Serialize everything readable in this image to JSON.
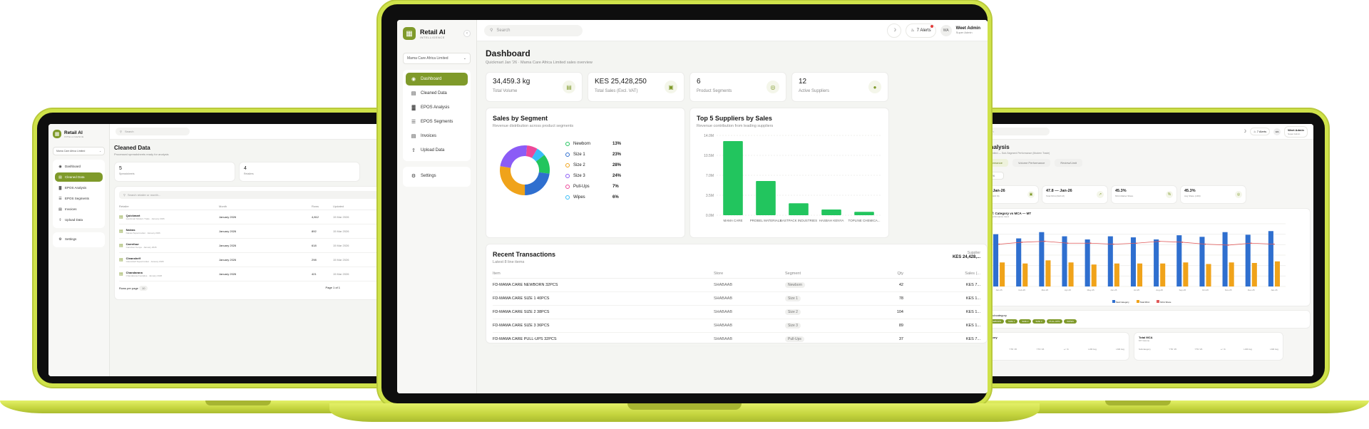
{
  "colors": {
    "accent": "#7f9a2a",
    "green": "#22c55e",
    "blue": "#2f6fcf",
    "orange": "#f0a31a",
    "red": "#e05a5a",
    "pink": "#ec4899"
  },
  "brand": {
    "name": "Retail AI",
    "tagline": "INTELLIGENCE"
  },
  "organization": "Mama Care Africa Limited",
  "nav": [
    {
      "label": "Dashboard",
      "icon": "dashboard-icon"
    },
    {
      "label": "Cleaned Data",
      "icon": "database-icon"
    },
    {
      "label": "EPOS Analysis",
      "icon": "bar-chart-icon"
    },
    {
      "label": "EPOS Segments",
      "icon": "layers-icon"
    },
    {
      "label": "Invoices",
      "icon": "file-icon"
    },
    {
      "label": "Upload Data",
      "icon": "upload-icon"
    }
  ],
  "settings_label": "Settings",
  "search_placeholder": "Search",
  "center": {
    "alerts": "7 Alerts",
    "user_initials": "WA",
    "user_name": "Weet Admin",
    "user_role": "Super Admin",
    "title": "Dashboard",
    "subtitle": "Quickmart Jan '26 · Mama Care Africa Limited sales overview",
    "kpis": [
      {
        "value": "34,459.3 kg",
        "label": "Total Volume",
        "icon": "bag-icon"
      },
      {
        "value": "KES 25,428,250",
        "label": "Total Sales (Excl. VAT)",
        "icon": "cash-icon"
      },
      {
        "value": "6",
        "label": "Product Segments",
        "icon": "target-icon"
      },
      {
        "value": "12",
        "label": "Active Suppliers",
        "icon": "truck-icon"
      }
    ],
    "segments_title": "Sales by Segment",
    "segments_sub": "Revenue distribution across product segments",
    "suppliers_title": "Top 5 Suppliers by Sales",
    "suppliers_sub": "Revenue contribution from leading suppliers",
    "tx_title": "Recent Transactions",
    "tx_sub": "Latest 8 line items",
    "tx_summary_label": "Supplier",
    "tx_summary_value": "KES 24,428,...",
    "tx_headers": [
      "Item",
      "Store",
      "Segment",
      "Qty",
      "Sales (..."
    ],
    "tx_rows": [
      [
        "FD-MAMA CARE NEWBORN 32PCS",
        "SHABAAB",
        "Newborn",
        "42",
        "KES 7..."
      ],
      [
        "FD-MAMA CARE SIZE 1 40PCS",
        "SHABAAB",
        "Size 1",
        "78",
        "KES 1..."
      ],
      [
        "FD-MAMA CARE SIZE 2 38PCS",
        "SHABAAB",
        "Size 2",
        "104",
        "KES 1..."
      ],
      [
        "FD-MAMA CARE SIZE 3 36PCS",
        "SHABAAB",
        "Size 3",
        "89",
        "KES 1..."
      ],
      [
        "FD-MAMA CARE PULL-UPS 32PCS",
        "SHABAAB",
        "Pull-Ups",
        "37",
        "KES 7..."
      ]
    ]
  },
  "left": {
    "title": "Cleaned Data",
    "subtitle": "Processed spreadsheets ready for analysis",
    "kpis": [
      {
        "value": "5",
        "label": "Spreadsheets"
      },
      {
        "value": "4",
        "label": "Retailers"
      }
    ],
    "table_search": "Search retailer or month...",
    "headers": [
      "Retailer",
      "Month",
      "Rows",
      "Updated"
    ],
    "rows": [
      {
        "name": "Quickmart",
        "sub": "Quickmart Modern Trade · January 2026",
        "month": "January 2026",
        "rows": "4,812",
        "updated": "15 Mar 2026"
      },
      {
        "name": "Naivas",
        "sub": "Naivas Supermarket · January 2026",
        "month": "January 2026",
        "rows": "892",
        "updated": "15 Mar 2026"
      },
      {
        "name": "Carrefour",
        "sub": "Carrefour Kenya · January 2026",
        "month": "January 2026",
        "rows": "618",
        "updated": "15 Mar 2026"
      },
      {
        "name": "Cleanshelf",
        "sub": "Cleanshelf Supermarket · January 2026",
        "month": "January 2026",
        "rows": "298",
        "updated": "15 Mar 2026"
      },
      {
        "name": "Chandarana",
        "sub": "Chandarana Foodplus · January 2026",
        "month": "January 2026",
        "rows": "421",
        "updated": "15 Mar 2026"
      }
    ],
    "rows_per_page_label": "Rows per page",
    "rows_per_page": "10",
    "page_info": "Page 1 of 1"
  },
  "right": {
    "alerts": "7 Alerts",
    "user_initials": "WA",
    "user_name": "Weet Admin",
    "user_role": "Super Admin",
    "title": "POS Analysis",
    "subtitle": "ma Care Africa Limited — Sub-Segment Performance (Modern Trade)",
    "tabs": [
      "Value Performance",
      "Volume Performance",
      "Review/Limit"
    ],
    "month_label": "Month",
    "month_value": "Jan 26",
    "kpis": [
      {
        "value": "105.6 — Jan-26",
        "label": "Total Category (KES M)",
        "icon": "wallet-icon"
      },
      {
        "value": "47.8 — Jan-26",
        "label": "Total MCA (KES M)",
        "icon": "trend-icon"
      },
      {
        "value": "45.3%",
        "label": "MCA Market Share",
        "icon": "percent-icon"
      },
      {
        "value": "45.3%",
        "label": "Avg Share (L3M)",
        "icon": "target-icon"
      }
    ],
    "chart_title": "Value Perf: Category vs MCA — MT",
    "chart_sub": "Monthly value performance trend",
    "legend": [
      "Total Category",
      "Total MCA",
      "MCA Share"
    ],
    "filter_label": "Filter by Subcategory",
    "chips": [
      "All",
      "NEWBORN",
      "SIZE 1",
      "SIZE 2",
      "SIZE 3",
      "PULL-UPS",
      "WIPES"
    ],
    "t1_title": "Total Category",
    "t1_sub": "MT Volume",
    "t2_title": "Total MCA",
    "t2_sub": "MT Volume",
    "t_headers": [
      "Subcategory",
      "YTD '25",
      "YTD '26",
      "+/- %",
      "L3M Avg",
      "L6M Avg"
    ]
  },
  "chart_data": [
    {
      "type": "pie",
      "title": "Sales by Segment",
      "categories": [
        "Newborn",
        "Size 1",
        "Size 2",
        "Size 3",
        "Pull-Ups",
        "Wipes"
      ],
      "values": [
        13,
        23,
        28,
        24,
        7,
        6
      ],
      "labels": [
        "13%",
        "23%",
        "28%",
        "24%",
        "7%",
        "6%"
      ],
      "colors": [
        "#22c55e",
        "#2f6fcf",
        "#f0a31a",
        "#8b5cf6",
        "#ec4899",
        "#38bdf8"
      ]
    },
    {
      "type": "bar",
      "title": "Top 5 Suppliers by Sales",
      "categories": [
        "MAMA CARE",
        "PROBEL MATERIALS",
        "EASTPACK INDUSTRIES",
        "HASBAH KENYA",
        "TOPLINE CHEMICA..."
      ],
      "values": [
        13.0,
        6.0,
        2.1,
        1.0,
        0.6
      ],
      "y_ticks": [
        "0.0M",
        "3.5M",
        "7.0M",
        "10.5M",
        "14.0M"
      ],
      "ylim": [
        0,
        14
      ]
    },
    {
      "type": "bar",
      "title": "Value Perf: Category vs MCA — MT",
      "categories": [
        "Jan-25",
        "Feb-25",
        "Mar-25",
        "Apr-25",
        "May-25",
        "Jun-25",
        "Jul-25",
        "Aug-25",
        "Sep-25",
        "Oct-25",
        "Nov-25",
        "Dec-25",
        "Jan-26"
      ],
      "series": [
        {
          "name": "Total Category",
          "values": [
            100,
            92,
            104,
            96,
            90,
            96,
            94,
            90,
            98,
            95,
            104,
            99,
            106
          ]
        },
        {
          "name": "Total MCA",
          "values": [
            46,
            44,
            50,
            46,
            42,
            44,
            44,
            44,
            46,
            43,
            46,
            45,
            48
          ]
        },
        {
          "name": "MCA Share",
          "values": [
            45,
            47,
            48,
            46,
            46,
            45,
            46,
            48,
            47,
            45,
            44,
            46,
            45
          ]
        }
      ],
      "ylim": [
        0,
        120
      ]
    }
  ]
}
